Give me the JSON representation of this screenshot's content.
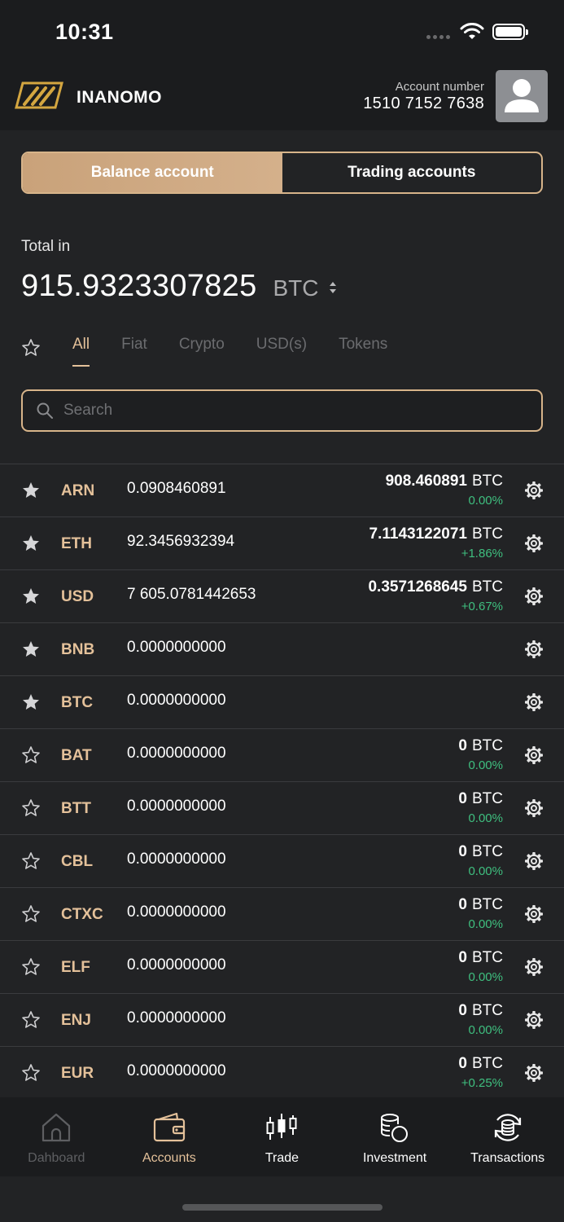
{
  "status": {
    "time": "10:31"
  },
  "header": {
    "brand": "INANOMO",
    "account_label": "Account number",
    "account_number": "1510 7152 7638"
  },
  "toggle": {
    "balance": "Balance account",
    "trading": "Trading accounts",
    "active": "balance"
  },
  "total": {
    "label": "Total in",
    "value": "915.9323307825",
    "unit": "BTC"
  },
  "filters": {
    "tabs": [
      "All",
      "Fiat",
      "Crypto",
      "USD(s)",
      "Tokens"
    ],
    "active": "All"
  },
  "search": {
    "placeholder": "Search"
  },
  "colors": {
    "accent": "#e4c19a",
    "positive": "#3fbf7f",
    "background": "#222325"
  },
  "assets": [
    {
      "symbol": "ARN",
      "amount": "0.0908460891",
      "value": "908.460891",
      "unit": "BTC",
      "change": "0.00%",
      "fav": true
    },
    {
      "symbol": "ETH",
      "amount": "92.3456932394",
      "value": "7.1143122071",
      "unit": "BTC",
      "change": "+1.86%",
      "fav": true
    },
    {
      "symbol": "USD",
      "amount": "7 605.0781442653",
      "value": "0.3571268645",
      "unit": "BTC",
      "change": "+0.67%",
      "fav": true
    },
    {
      "symbol": "BNB",
      "amount": "0.0000000000",
      "value": "",
      "unit": "",
      "change": "",
      "fav": true
    },
    {
      "symbol": "BTC",
      "amount": "0.0000000000",
      "value": "",
      "unit": "",
      "change": "",
      "fav": true
    },
    {
      "symbol": "BAT",
      "amount": "0.0000000000",
      "value": "0",
      "unit": "BTC",
      "change": "0.00%",
      "fav": false
    },
    {
      "symbol": "BTT",
      "amount": "0.0000000000",
      "value": "0",
      "unit": "BTC",
      "change": "0.00%",
      "fav": false
    },
    {
      "symbol": "CBL",
      "amount": "0.0000000000",
      "value": "0",
      "unit": "BTC",
      "change": "0.00%",
      "fav": false
    },
    {
      "symbol": "CTXC",
      "amount": "0.0000000000",
      "value": "0",
      "unit": "BTC",
      "change": "0.00%",
      "fav": false
    },
    {
      "symbol": "ELF",
      "amount": "0.0000000000",
      "value": "0",
      "unit": "BTC",
      "change": "0.00%",
      "fav": false
    },
    {
      "symbol": "ENJ",
      "amount": "0.0000000000",
      "value": "0",
      "unit": "BTC",
      "change": "0.00%",
      "fav": false
    },
    {
      "symbol": "EUR",
      "amount": "0.0000000000",
      "value": "0",
      "unit": "BTC",
      "change": "+0.25%",
      "fav": false
    }
  ],
  "nav": [
    {
      "label": "Dahboard",
      "icon": "home-icon",
      "state": "dim"
    },
    {
      "label": "Accounts",
      "icon": "wallet-icon",
      "state": "active"
    },
    {
      "label": "Trade",
      "icon": "candlestick-icon",
      "state": "normal"
    },
    {
      "label": "Investment",
      "icon": "coins-icon",
      "state": "normal"
    },
    {
      "label": "Transactions",
      "icon": "exchange-icon",
      "state": "normal"
    }
  ]
}
